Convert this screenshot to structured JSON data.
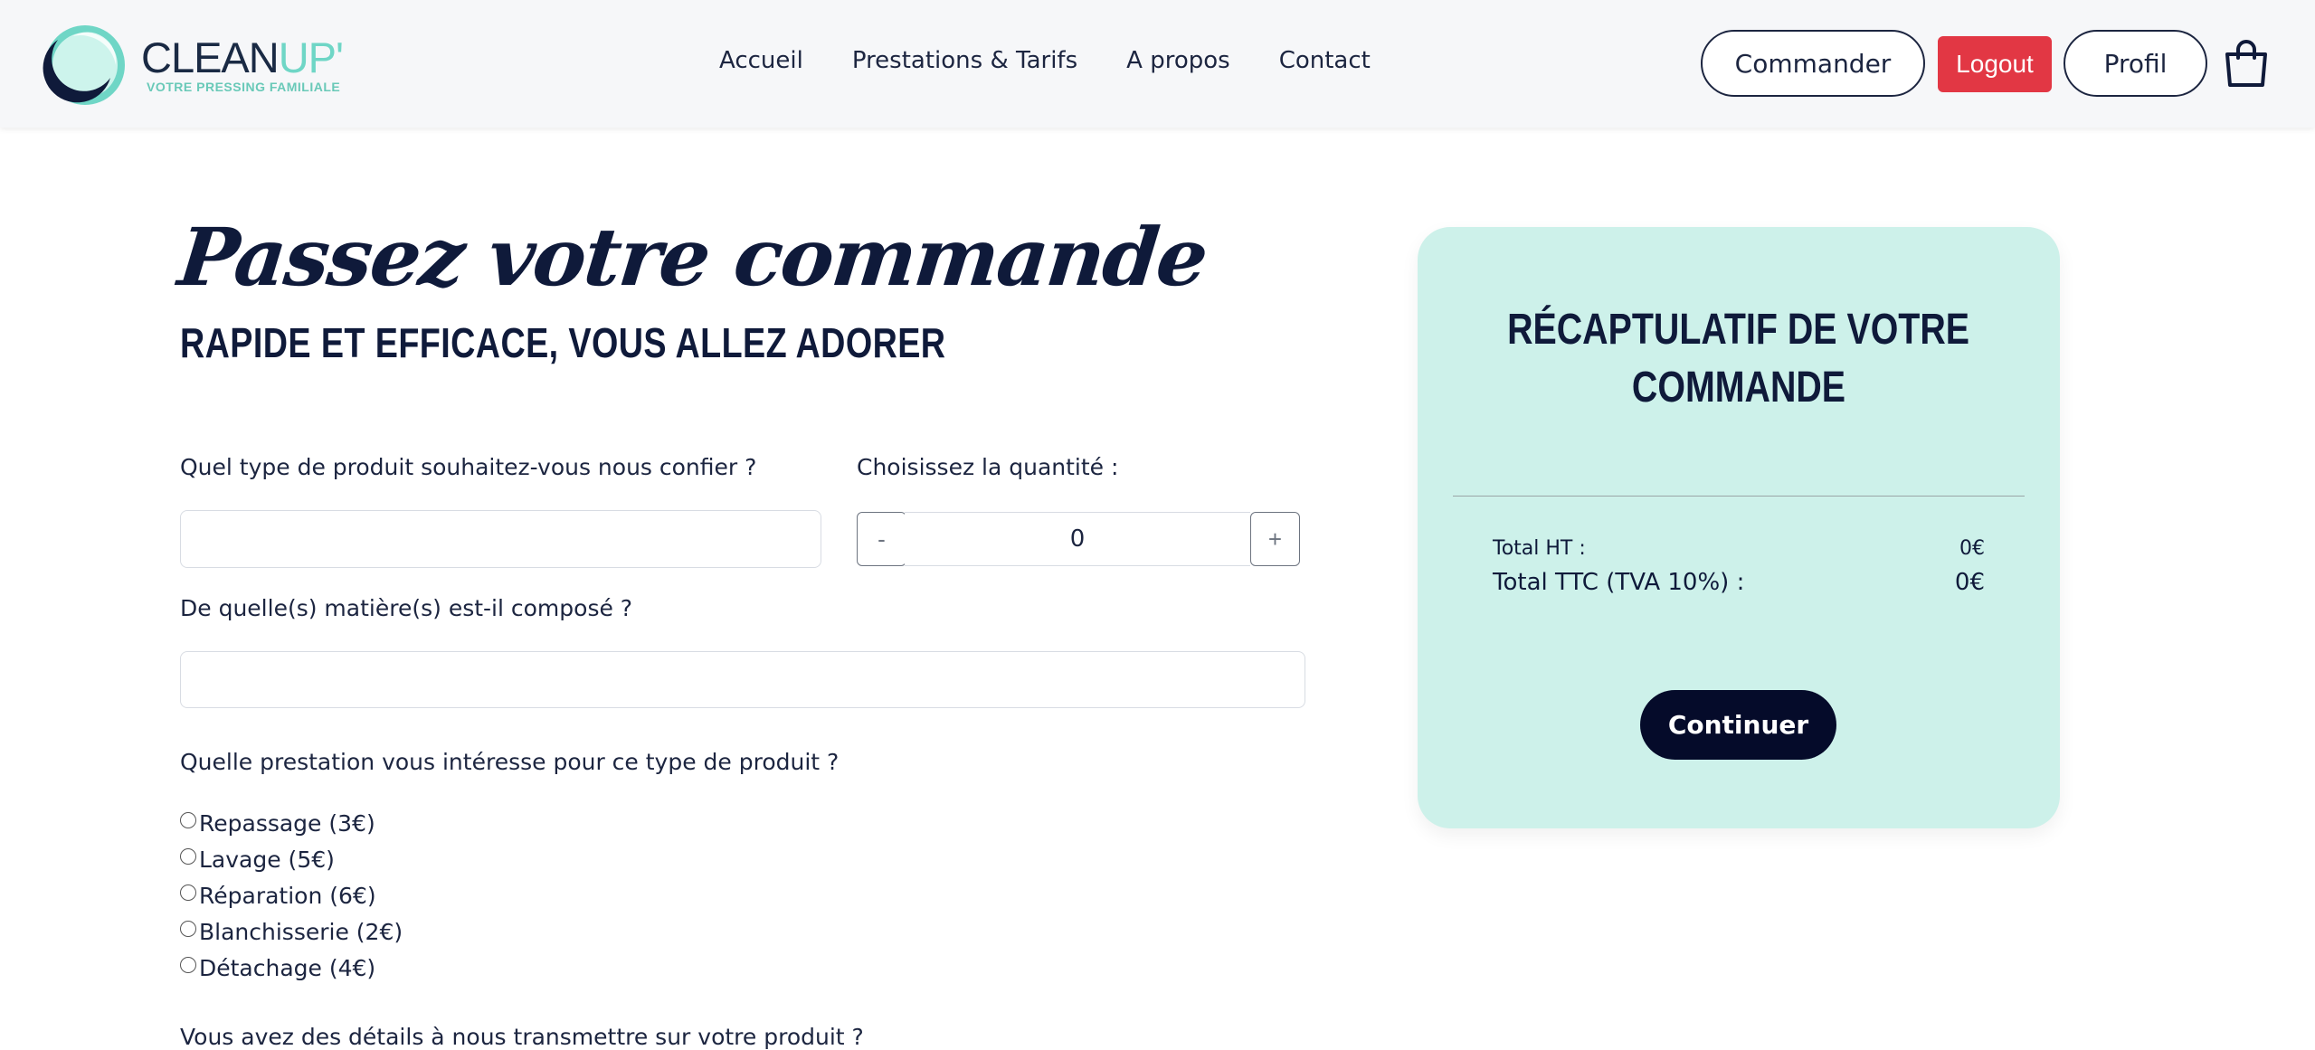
{
  "header": {
    "logo": {
      "name_main": "CLEAN",
      "name_accent": "UP'",
      "tagline": "VOTRE PRESSING FAMILIALE"
    },
    "nav": [
      {
        "label": "Accueil"
      },
      {
        "label": "Prestations & Tarifs"
      },
      {
        "label": "A propos"
      },
      {
        "label": "Contact"
      }
    ],
    "commander_label": "Commander",
    "logout_label": "Logout",
    "profil_label": "Profil",
    "cart_icon": "shopping-bag-icon"
  },
  "form": {
    "title": "Passez votre commande",
    "subtitle": "RAPIDE ET EFFICACE, VOUS ALLEZ ADORER",
    "product_label": "Quel type de produit souhaitez-vous nous confier ?",
    "product_value": "",
    "quantity_label": "Choisissez la quantité :",
    "quantity_minus": "-",
    "quantity_value": "0",
    "quantity_plus": "+",
    "material_label": "De quelle(s) matière(s) est-il composé ?",
    "material_value": "",
    "service_label": "Quelle prestation vous intéresse pour ce type de produit ?",
    "services": [
      {
        "label": "Repassage (3€)"
      },
      {
        "label": "Lavage (5€)"
      },
      {
        "label": "Réparation (6€)"
      },
      {
        "label": "Blanchisserie (2€)"
      },
      {
        "label": "Détachage (4€)"
      }
    ],
    "details_label": "Vous avez des détails à nous transmettre sur votre produit ?"
  },
  "summary": {
    "title_line1": "RÉCAPTULATIF DE VOTRE",
    "title_line2": "COMMANDE",
    "total_ht_label": "Total HT :",
    "total_ht_value": "0€",
    "total_ttc_label": "Total TTC (TVA 10%) :",
    "total_ttc_value": "0€",
    "continue_label": "Continuer"
  },
  "colors": {
    "brand_teal": "#6fd6c6",
    "navy": "#0f1a3a",
    "logout_red": "#e23744",
    "card_bg": "#cdf1ea",
    "continue_bg": "#050b2a"
  }
}
